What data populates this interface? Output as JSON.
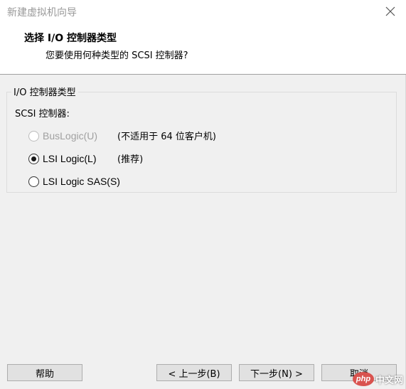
{
  "window": {
    "title": "新建虚拟机向导",
    "close_icon": "close-icon"
  },
  "header": {
    "title": "选择 I/O 控制器类型",
    "subtitle": "您要使用何种类型的 SCSI 控制器?"
  },
  "group": {
    "legend": "I/O 控制器类型",
    "scsi_label": "SCSI 控制器:"
  },
  "options": [
    {
      "label": "BusLogic(U)",
      "note": "(不适用于 64 位客户机)",
      "checked": false,
      "disabled": true
    },
    {
      "label": "LSI Logic(L)",
      "note": "(推荐)",
      "checked": true,
      "disabled": false
    },
    {
      "label": "LSI Logic SAS(S)",
      "note": "",
      "checked": false,
      "disabled": false
    }
  ],
  "buttons": {
    "help": "帮助",
    "back": "< 上一步(B)",
    "next": "下一步(N) >",
    "cancel": "取消"
  },
  "watermark": {
    "logo": "php",
    "text": "中文网"
  }
}
